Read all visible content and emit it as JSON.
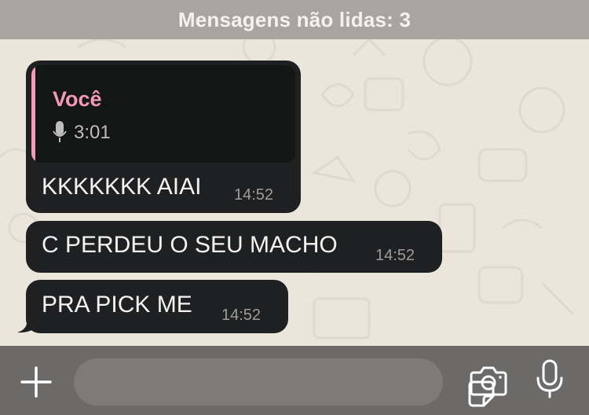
{
  "unread_banner": {
    "text": "Mensagens não lidas: 3"
  },
  "messages": [
    {
      "reply": {
        "author": "Você",
        "icon": "mic-icon",
        "duration": "3:01"
      },
      "text": "KKKKKKK AIAI",
      "time": "14:52"
    },
    {
      "text": "C PERDEU O SEU MACHO",
      "time": "14:52"
    },
    {
      "text": "PRA PICK ME",
      "time": "14:52"
    }
  ],
  "composer": {
    "icons": [
      "plus-icon",
      "sticker-icon",
      "camera-icon",
      "mic-icon"
    ]
  },
  "colors": {
    "background": "#ebe5dc",
    "banner": "#a8a59f",
    "bubble": "#1f2021",
    "reply_accent": "#f29ab8",
    "input_bar": "#6b6a68"
  }
}
